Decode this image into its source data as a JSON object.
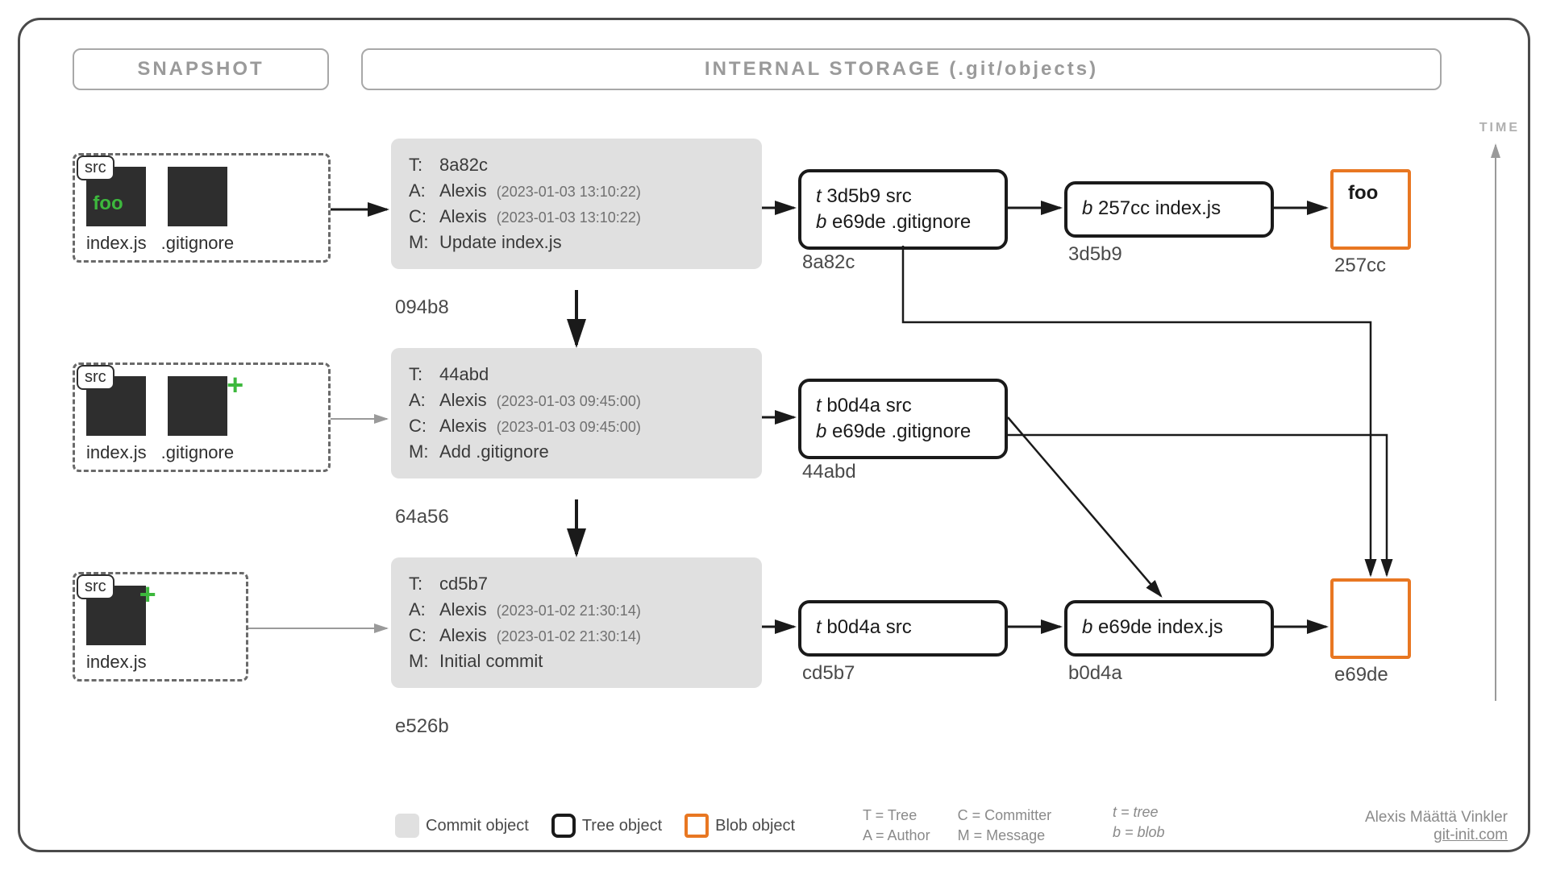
{
  "headers": {
    "snapshot": "SNAPSHOT",
    "internal": "INTERNAL STORAGE (.git/objects)"
  },
  "time_label": "TIME",
  "snapshots": {
    "s1": {
      "src_tag": "src",
      "file1_name": "index.js",
      "file1_content": "foo",
      "file2_name": ".gitignore"
    },
    "s2": {
      "src_tag": "src",
      "file1_name": "index.js",
      "file2_name": ".gitignore"
    },
    "s3": {
      "src_tag": "src",
      "file1_name": "index.js"
    }
  },
  "commits": {
    "c1": {
      "hash": "094b8",
      "T_key": "T:",
      "T_val": "8a82c",
      "A_key": "A:",
      "A_name": "Alexis",
      "A_date": "(2023-01-03 13:10:22)",
      "C_key": "C:",
      "C_name": "Alexis",
      "C_date": "(2023-01-03 13:10:22)",
      "M_key": "M:",
      "M_val": "Update index.js"
    },
    "c2": {
      "hash": "64a56",
      "T_key": "T:",
      "T_val": "44abd",
      "A_key": "A:",
      "A_name": "Alexis",
      "A_date": "(2023-01-03 09:45:00)",
      "C_key": "C:",
      "C_name": "Alexis",
      "C_date": "(2023-01-03 09:45:00)",
      "M_key": "M:",
      "M_val": "Add .gitignore"
    },
    "c3": {
      "hash": "e526b",
      "T_key": "T:",
      "T_val": "cd5b7",
      "A_key": "A:",
      "A_name": "Alexis",
      "A_date": "(2023-01-02 21:30:14)",
      "C_key": "C:",
      "C_name": "Alexis",
      "C_date": "(2023-01-02 21:30:14)",
      "M_key": "M:",
      "M_val": "Initial commit"
    }
  },
  "trees": {
    "t1": {
      "hash": "8a82c",
      "row1_type": "t",
      "row1_hash": "3d5b9",
      "row1_name": "src",
      "row2_type": "b",
      "row2_hash": "e69de",
      "row2_name": ".gitignore"
    },
    "t2": {
      "hash": "44abd",
      "row1_type": "t",
      "row1_hash": "b0d4a",
      "row1_name": "src",
      "row2_type": "b",
      "row2_hash": "e69de",
      "row2_name": ".gitignore"
    },
    "t3": {
      "hash": "cd5b7",
      "row1_type": "t",
      "row1_hash": "b0d4a",
      "row1_name": "src"
    },
    "t4": {
      "hash": "3d5b9",
      "row1_type": "b",
      "row1_hash": "257cc",
      "row1_name": "index.js"
    },
    "t5": {
      "hash": "b0d4a",
      "row1_type": "b",
      "row1_hash": "e69de",
      "row1_name": "index.js"
    }
  },
  "blobs": {
    "b1": {
      "hash": "257cc",
      "content": "foo"
    },
    "b2": {
      "hash": "e69de",
      "content": ""
    }
  },
  "legend": {
    "commit": "Commit object",
    "tree": "Tree object",
    "blob": "Blob object",
    "T": "T = Tree",
    "A": "A = Author",
    "C": "C = Committer",
    "M": "M = Message",
    "t": "t = tree",
    "b": "b = blob"
  },
  "credit": {
    "name": "Alexis Määttä Vinkler",
    "url": "git-init.com"
  }
}
